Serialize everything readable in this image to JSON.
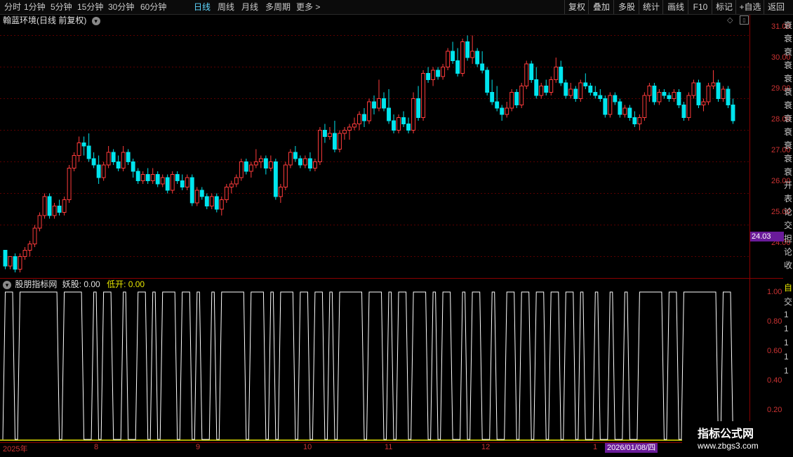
{
  "toolbar": {
    "periods": [
      "分时",
      "1分钟",
      "5分钟",
      "15分钟",
      "30分钟",
      "60分钟",
      "日线",
      "周线",
      "月线",
      "多周期",
      "更多 >"
    ],
    "active_period": "日线",
    "actions": [
      "复权",
      "叠加",
      "多股",
      "统计",
      "画线",
      "F10",
      "标记",
      "+自选",
      "返回"
    ]
  },
  "main_title": "翰蓝环境(日线 前复权)",
  "indicator": {
    "name": "股朋指标网",
    "label1": "妖股: 0.00",
    "label2": "低开: 0.00",
    "label2_color": "#e6e600"
  },
  "price_axis": [
    "31.00",
    "30.00",
    "29.00",
    "28.00",
    "27.00",
    "26.00",
    "25.00",
    "24.00"
  ],
  "current_price_badge": "24.03",
  "indicator_axis": [
    "1.00",
    "0.80",
    "0.60",
    "0.40",
    "0.20"
  ],
  "date_labels": [
    "2025年",
    "8",
    "9",
    "10",
    "11",
    "12",
    "1"
  ],
  "cursor_date": "2026/01/08/四",
  "sidebar_chars": [
    "衰",
    "衰",
    "衰",
    "衰",
    "衰",
    "衰",
    "衰",
    "衰",
    "衰",
    "衰",
    "衰",
    "衰",
    "开",
    "表",
    "论",
    "交",
    "担",
    "论",
    "收"
  ],
  "sidebar_lower": [
    "自",
    "交",
    "1",
    "1",
    "1",
    "1",
    "1"
  ],
  "watermark": {
    "line1": "指标公式网",
    "line2": "www.zbgs3.com"
  },
  "colors": {
    "up": "#ff3b3b",
    "down": "#00e5ee",
    "grid": "#5a0000",
    "axis": "#8b0000",
    "indicator_line": "#ffffff",
    "baseline": "#e6e600"
  },
  "chart_data": {
    "type": "candlestick",
    "ylim": [
      23.3,
      31.3
    ],
    "candles": [
      [
        24.2,
        24.2,
        23.6,
        23.7
      ],
      [
        23.7,
        24.0,
        23.6,
        24.0
      ],
      [
        24.0,
        24.1,
        23.5,
        23.6
      ],
      [
        23.6,
        24.1,
        23.5,
        24.0
      ],
      [
        24.0,
        24.3,
        23.9,
        24.2
      ],
      [
        24.2,
        24.5,
        24.0,
        24.4
      ],
      [
        24.4,
        25.0,
        24.3,
        24.9
      ],
      [
        24.9,
        25.4,
        24.8,
        25.3
      ],
      [
        25.3,
        26.0,
        25.2,
        25.9
      ],
      [
        25.9,
        26.0,
        25.2,
        25.3
      ],
      [
        25.3,
        25.7,
        25.2,
        25.6
      ],
      [
        25.6,
        25.8,
        25.3,
        25.4
      ],
      [
        25.4,
        25.9,
        25.3,
        25.8
      ],
      [
        25.8,
        26.9,
        25.7,
        26.8
      ],
      [
        26.8,
        27.3,
        26.7,
        27.2
      ],
      [
        27.2,
        27.8,
        27.0,
        27.6
      ],
      [
        27.6,
        27.8,
        27.2,
        27.5
      ],
      [
        27.5,
        27.9,
        27.0,
        27.1
      ],
      [
        27.1,
        27.3,
        26.8,
        26.9
      ],
      [
        26.9,
        27.2,
        26.3,
        26.5
      ],
      [
        26.5,
        27.0,
        26.4,
        26.9
      ],
      [
        26.9,
        27.5,
        26.8,
        27.3
      ],
      [
        27.3,
        27.4,
        26.9,
        27.0
      ],
      [
        27.0,
        27.2,
        26.7,
        26.8
      ],
      [
        26.8,
        27.5,
        26.7,
        27.3
      ],
      [
        27.3,
        27.4,
        26.9,
        27.0
      ],
      [
        27.0,
        27.1,
        26.5,
        26.7
      ],
      [
        26.7,
        26.8,
        26.3,
        26.4
      ],
      [
        26.4,
        26.7,
        26.3,
        26.6
      ],
      [
        26.6,
        26.8,
        26.3,
        26.4
      ],
      [
        26.4,
        26.8,
        26.3,
        26.6
      ],
      [
        26.6,
        26.7,
        26.2,
        26.3
      ],
      [
        26.3,
        26.6,
        26.2,
        26.5
      ],
      [
        26.5,
        26.6,
        26.0,
        26.1
      ],
      [
        26.1,
        26.7,
        26.0,
        26.6
      ],
      [
        26.6,
        26.7,
        26.3,
        26.4
      ],
      [
        26.4,
        26.6,
        26.1,
        26.2
      ],
      [
        26.2,
        26.6,
        26.1,
        26.5
      ],
      [
        26.5,
        26.6,
        25.6,
        25.7
      ],
      [
        25.7,
        26.2,
        25.6,
        26.1
      ],
      [
        26.1,
        26.2,
        25.8,
        25.9
      ],
      [
        25.9,
        26.0,
        25.5,
        25.6
      ],
      [
        25.6,
        26.0,
        25.5,
        25.9
      ],
      [
        25.9,
        26.0,
        25.4,
        25.5
      ],
      [
        25.5,
        25.9,
        25.3,
        25.8
      ],
      [
        25.8,
        26.3,
        25.7,
        26.2
      ],
      [
        26.2,
        26.4,
        26.0,
        26.3
      ],
      [
        26.3,
        26.6,
        26.2,
        26.5
      ],
      [
        26.5,
        27.1,
        26.4,
        27.0
      ],
      [
        27.0,
        27.1,
        26.6,
        26.7
      ],
      [
        26.7,
        27.0,
        26.5,
        26.9
      ],
      [
        26.9,
        27.4,
        26.8,
        27.0
      ],
      [
        27.0,
        27.2,
        26.8,
        27.1
      ],
      [
        27.1,
        27.2,
        26.6,
        26.8
      ],
      [
        26.8,
        27.2,
        26.7,
        27.0
      ],
      [
        27.0,
        27.1,
        25.8,
        25.9
      ],
      [
        25.9,
        26.3,
        25.7,
        26.2
      ],
      [
        26.2,
        27.0,
        26.1,
        26.9
      ],
      [
        26.9,
        27.4,
        26.8,
        27.3
      ],
      [
        27.3,
        27.5,
        27.0,
        27.1
      ],
      [
        27.1,
        27.2,
        26.8,
        26.9
      ],
      [
        26.9,
        27.2,
        26.8,
        27.1
      ],
      [
        27.1,
        27.3,
        26.7,
        26.8
      ],
      [
        26.8,
        27.1,
        26.7,
        27.0
      ],
      [
        27.0,
        28.1,
        26.9,
        28.0
      ],
      [
        28.0,
        28.2,
        27.6,
        27.8
      ],
      [
        27.8,
        28.1,
        27.7,
        27.9
      ],
      [
        27.9,
        28.3,
        27.3,
        27.4
      ],
      [
        27.4,
        28.0,
        27.3,
        27.9
      ],
      [
        27.9,
        28.1,
        27.7,
        28.0
      ],
      [
        28.0,
        28.2,
        27.7,
        28.1
      ],
      [
        28.1,
        28.4,
        28.0,
        28.2
      ],
      [
        28.2,
        28.6,
        28.0,
        28.5
      ],
      [
        28.5,
        28.7,
        28.1,
        28.3
      ],
      [
        28.3,
        29.0,
        28.2,
        28.9
      ],
      [
        28.9,
        29.1,
        28.5,
        28.7
      ],
      [
        28.7,
        29.6,
        28.6,
        29.0
      ],
      [
        29.0,
        29.2,
        28.6,
        28.7
      ],
      [
        28.7,
        29.3,
        28.2,
        28.3
      ],
      [
        28.3,
        28.5,
        27.9,
        28.0
      ],
      [
        28.0,
        28.5,
        27.9,
        28.4
      ],
      [
        28.4,
        28.6,
        28.1,
        28.2
      ],
      [
        28.2,
        28.4,
        27.9,
        28.0
      ],
      [
        28.0,
        29.2,
        27.9,
        29.0
      ],
      [
        29.0,
        29.4,
        28.3,
        28.4
      ],
      [
        28.4,
        29.9,
        28.3,
        29.8
      ],
      [
        29.8,
        30.0,
        29.5,
        29.6
      ],
      [
        29.6,
        30.0,
        29.4,
        29.9
      ],
      [
        29.9,
        30.0,
        29.6,
        29.7
      ],
      [
        29.7,
        30.1,
        29.6,
        30.0
      ],
      [
        30.0,
        30.6,
        29.9,
        30.5
      ],
      [
        30.5,
        30.8,
        30.1,
        30.2
      ],
      [
        30.2,
        30.6,
        29.7,
        29.8
      ],
      [
        29.8,
        30.9,
        29.7,
        30.8
      ],
      [
        30.8,
        31.0,
        30.2,
        30.3
      ],
      [
        30.3,
        31.0,
        30.1,
        30.5
      ],
      [
        30.5,
        30.6,
        30.0,
        30.1
      ],
      [
        30.1,
        30.5,
        29.8,
        29.9
      ],
      [
        29.9,
        30.0,
        29.1,
        29.2
      ],
      [
        29.2,
        29.6,
        28.8,
        28.9
      ],
      [
        28.9,
        29.4,
        28.6,
        28.7
      ],
      [
        28.7,
        28.8,
        28.3,
        28.5
      ],
      [
        28.5,
        28.9,
        28.4,
        28.7
      ],
      [
        28.7,
        29.3,
        28.6,
        29.2
      ],
      [
        29.2,
        29.3,
        28.7,
        28.8
      ],
      [
        28.8,
        29.5,
        28.7,
        29.4
      ],
      [
        29.4,
        30.2,
        29.3,
        30.1
      ],
      [
        30.1,
        30.2,
        29.5,
        29.6
      ],
      [
        29.6,
        30.0,
        29.0,
        29.1
      ],
      [
        29.1,
        29.5,
        29.0,
        29.4
      ],
      [
        29.4,
        29.6,
        29.1,
        29.2
      ],
      [
        29.2,
        29.7,
        29.1,
        29.6
      ],
      [
        29.6,
        30.3,
        29.5,
        30.0
      ],
      [
        30.0,
        30.2,
        29.4,
        29.5
      ],
      [
        29.5,
        29.6,
        29.0,
        29.1
      ],
      [
        29.1,
        29.5,
        29.0,
        29.3
      ],
      [
        29.3,
        29.4,
        28.9,
        29.0
      ],
      [
        29.0,
        29.6,
        28.9,
        29.5
      ],
      [
        29.5,
        29.8,
        29.3,
        29.4
      ],
      [
        29.4,
        29.5,
        29.1,
        29.2
      ],
      [
        29.2,
        29.4,
        29.0,
        29.1
      ],
      [
        29.1,
        29.3,
        28.9,
        29.0
      ],
      [
        29.0,
        29.1,
        28.4,
        28.5
      ],
      [
        28.5,
        29.2,
        28.4,
        29.1
      ],
      [
        29.1,
        29.2,
        28.8,
        28.9
      ],
      [
        28.9,
        29.0,
        28.4,
        28.5
      ],
      [
        28.5,
        28.8,
        28.4,
        28.7
      ],
      [
        28.7,
        28.8,
        28.3,
        28.4
      ],
      [
        28.4,
        28.6,
        28.1,
        28.2
      ],
      [
        28.2,
        28.5,
        28.0,
        28.4
      ],
      [
        28.4,
        29.2,
        28.3,
        29.1
      ],
      [
        29.1,
        29.5,
        28.9,
        29.4
      ],
      [
        29.4,
        29.5,
        28.8,
        28.9
      ],
      [
        28.9,
        29.3,
        28.8,
        29.2
      ],
      [
        29.2,
        29.3,
        29.0,
        29.1
      ],
      [
        29.1,
        29.2,
        28.9,
        29.0
      ],
      [
        29.0,
        29.3,
        28.9,
        29.2
      ],
      [
        29.2,
        29.3,
        28.7,
        28.8
      ],
      [
        28.8,
        28.9,
        28.3,
        28.4
      ],
      [
        28.4,
        29.2,
        28.3,
        29.1
      ],
      [
        29.1,
        29.6,
        29.0,
        29.5
      ],
      [
        29.5,
        29.6,
        28.7,
        28.8
      ],
      [
        28.8,
        29.0,
        28.6,
        28.9
      ],
      [
        28.9,
        29.5,
        28.8,
        29.4
      ],
      [
        29.4,
        29.9,
        29.3,
        29.5
      ],
      [
        29.5,
        29.6,
        28.9,
        29.0
      ],
      [
        29.0,
        29.4,
        28.9,
        29.3
      ],
      [
        29.3,
        29.4,
        28.7,
        28.8
      ],
      [
        28.8,
        29.0,
        28.2,
        28.3
      ]
    ],
    "indicator_levels": [
      1.0,
      0.8,
      0.6,
      0.4,
      0.2
    ]
  }
}
